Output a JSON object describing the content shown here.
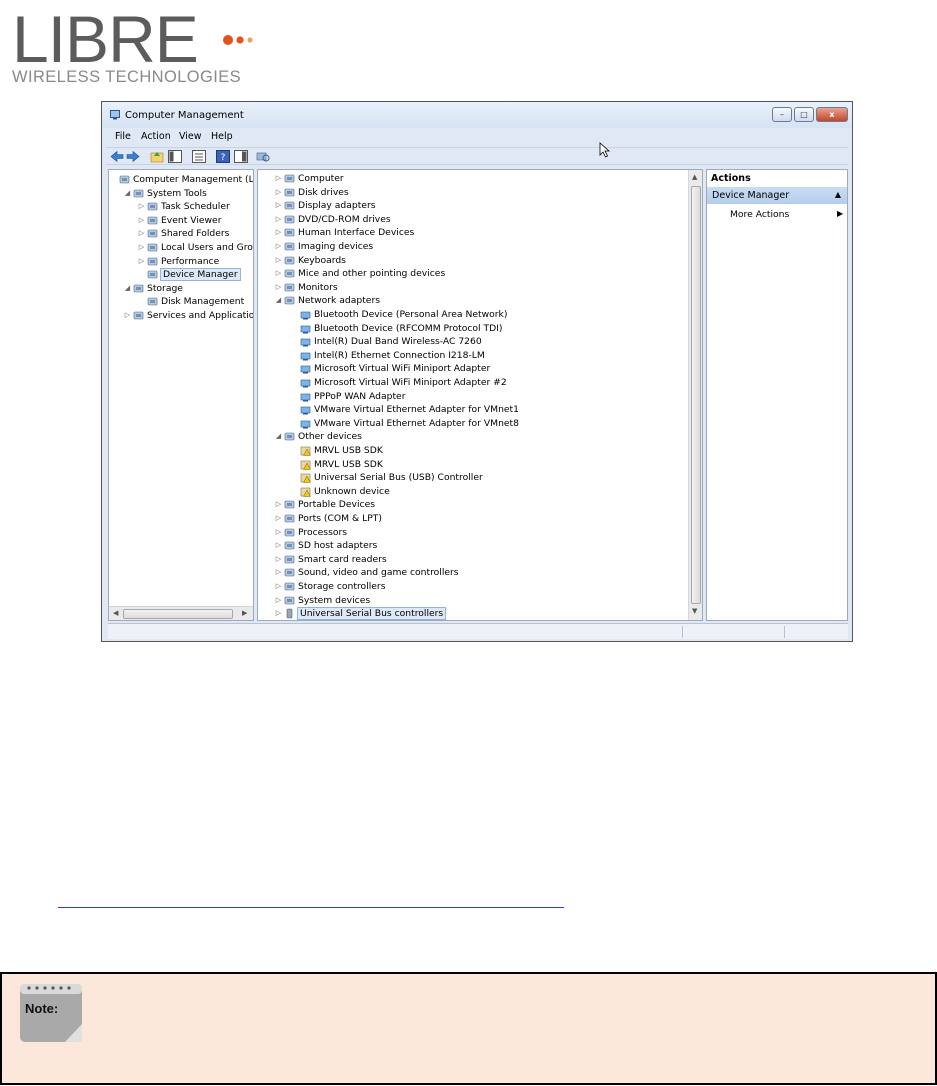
{
  "logo": {
    "word": "LIBRE",
    "subtitle": "WIRELESS TECHNOLOGIES",
    "dot_colors": [
      "#e4531d",
      "#e4531d",
      "#f0a070"
    ]
  },
  "window": {
    "title": "Computer Management",
    "controls": {
      "minimize": "–",
      "maximize": "□",
      "close": "x"
    }
  },
  "menu": [
    "File",
    "Action",
    "View",
    "Help"
  ],
  "toolbar_icons": [
    "back-arrow-icon",
    "forward-arrow-icon",
    "up-folder-icon",
    "show-hide-tree-icon",
    "properties-icon",
    "help-icon",
    "action-pane-icon",
    "scan-hardware-icon"
  ],
  "left_tree": [
    {
      "label": "Computer Management (Local",
      "indent": 0,
      "expander": "",
      "icon": "computer-management-icon"
    },
    {
      "label": "System Tools",
      "indent": 1,
      "expander": "◢",
      "icon": "system-tools-icon"
    },
    {
      "label": "Task Scheduler",
      "indent": 2,
      "expander": "▷",
      "icon": "clock-icon"
    },
    {
      "label": "Event Viewer",
      "indent": 2,
      "expander": "▷",
      "icon": "event-viewer-icon"
    },
    {
      "label": "Shared Folders",
      "indent": 2,
      "expander": "▷",
      "icon": "shared-folder-icon"
    },
    {
      "label": "Local Users and Groups",
      "indent": 2,
      "expander": "▷",
      "icon": "users-icon"
    },
    {
      "label": "Performance",
      "indent": 2,
      "expander": "▷",
      "icon": "performance-icon"
    },
    {
      "label": "Device Manager",
      "indent": 2,
      "expander": "",
      "icon": "device-manager-icon",
      "selected": true
    },
    {
      "label": "Storage",
      "indent": 1,
      "expander": "◢",
      "icon": "storage-icon"
    },
    {
      "label": "Disk Management",
      "indent": 2,
      "expander": "",
      "icon": "disk-icon"
    },
    {
      "label": "Services and Applications",
      "indent": 1,
      "expander": "▷",
      "icon": "services-icon"
    }
  ],
  "device_tree": [
    {
      "label": "Computer",
      "level": 0,
      "expander": "▷",
      "icon": "computer-icon"
    },
    {
      "label": "Disk drives",
      "level": 0,
      "expander": "▷",
      "icon": "disk-drive-icon"
    },
    {
      "label": "Display adapters",
      "level": 0,
      "expander": "▷",
      "icon": "display-adapter-icon"
    },
    {
      "label": "DVD/CD-ROM drives",
      "level": 0,
      "expander": "▷",
      "icon": "dvd-icon"
    },
    {
      "label": "Human Interface Devices",
      "level": 0,
      "expander": "▷",
      "icon": "hid-icon"
    },
    {
      "label": "Imaging devices",
      "level": 0,
      "expander": "▷",
      "icon": "camera-icon"
    },
    {
      "label": "Keyboards",
      "level": 0,
      "expander": "▷",
      "icon": "keyboard-icon"
    },
    {
      "label": "Mice and other pointing devices",
      "level": 0,
      "expander": "▷",
      "icon": "mouse-icon"
    },
    {
      "label": "Monitors",
      "level": 0,
      "expander": "▷",
      "icon": "monitor-icon"
    },
    {
      "label": "Network adapters",
      "level": 0,
      "expander": "◢",
      "icon": "network-icon"
    },
    {
      "label": "Bluetooth Device (Personal Area Network)",
      "level": 1,
      "icon": "network-adapter-icon"
    },
    {
      "label": "Bluetooth Device (RFCOMM Protocol TDI)",
      "level": 1,
      "icon": "network-adapter-icon"
    },
    {
      "label": "Intel(R) Dual Band Wireless-AC 7260",
      "level": 1,
      "icon": "network-adapter-icon"
    },
    {
      "label": "Intel(R) Ethernet Connection I218-LM",
      "level": 1,
      "icon": "network-adapter-icon"
    },
    {
      "label": "Microsoft Virtual WiFi Miniport Adapter",
      "level": 1,
      "icon": "network-adapter-icon"
    },
    {
      "label": "Microsoft Virtual WiFi Miniport Adapter #2",
      "level": 1,
      "icon": "network-adapter-icon"
    },
    {
      "label": "PPPoP WAN Adapter",
      "level": 1,
      "icon": "network-adapter-icon"
    },
    {
      "label": "VMware Virtual Ethernet Adapter for VMnet1",
      "level": 1,
      "icon": "network-adapter-icon"
    },
    {
      "label": "VMware Virtual Ethernet Adapter for VMnet8",
      "level": 1,
      "icon": "network-adapter-icon"
    },
    {
      "label": "Other devices",
      "level": 0,
      "expander": "◢",
      "icon": "other-devices-icon"
    },
    {
      "label": "MRVL USB SDK",
      "level": 1,
      "icon": "warning-device-icon"
    },
    {
      "label": "MRVL USB SDK",
      "level": 1,
      "icon": "warning-device-icon"
    },
    {
      "label": "Universal Serial Bus (USB) Controller",
      "level": 1,
      "icon": "warning-device-icon"
    },
    {
      "label": "Unknown device",
      "level": 1,
      "icon": "warning-device-icon"
    },
    {
      "label": "Portable Devices",
      "level": 0,
      "expander": "▷",
      "icon": "portable-device-icon"
    },
    {
      "label": "Ports (COM & LPT)",
      "level": 0,
      "expander": "▷",
      "icon": "port-icon"
    },
    {
      "label": "Processors",
      "level": 0,
      "expander": "▷",
      "icon": "processor-icon"
    },
    {
      "label": "SD host adapters",
      "level": 0,
      "expander": "▷",
      "icon": "sd-card-icon"
    },
    {
      "label": "Smart card readers",
      "level": 0,
      "expander": "▷",
      "icon": "smart-card-icon"
    },
    {
      "label": "Sound, video and game controllers",
      "level": 0,
      "expander": "▷",
      "icon": "sound-icon"
    },
    {
      "label": "Storage controllers",
      "level": 0,
      "expander": "▷",
      "icon": "storage-controller-icon"
    },
    {
      "label": "System devices",
      "level": 0,
      "expander": "▷",
      "icon": "system-device-icon"
    },
    {
      "label": "Universal Serial Bus controllers",
      "level": 0,
      "expander": "▷",
      "icon": "usb-icon",
      "selected": true
    }
  ],
  "actions": {
    "header": "Actions",
    "section": "Device Manager",
    "item": "More Actions"
  },
  "note": {
    "label": "Note:"
  }
}
